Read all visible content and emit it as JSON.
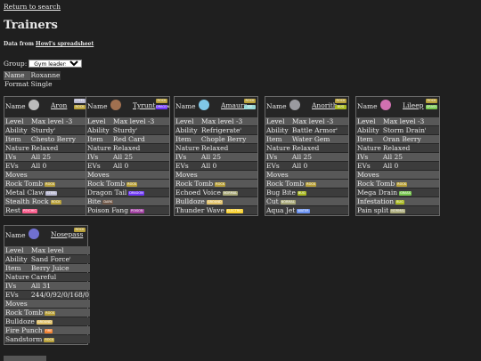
{
  "nav": {
    "back_link": "Return to search"
  },
  "page": {
    "title": "Trainers",
    "data_from_prefix": "Data from ",
    "data_from_link": "Howl's spreadsheet"
  },
  "filter": {
    "group_label": "Group:",
    "group_value": "Gym leaders"
  },
  "trainer": {
    "name_key": "Name",
    "name": "Roxanne",
    "format_key": "Format",
    "format": "Single"
  },
  "labels": {
    "name": "Name",
    "level": "Level",
    "ability": "Ability",
    "item": "Item",
    "nature": "Nature",
    "ivs": "IVs",
    "evs": "EVs",
    "moves": "Moves"
  },
  "type_colors": {
    "ROCK": "#b8a038",
    "STEEL": "#b8b8d0",
    "DRAGON": "#7038f8",
    "DARK": "#705848",
    "POISON": "#a040a0",
    "GRASS": "#78c850",
    "ELECTRIC": "#f8d030",
    "NORMAL": "#a8a878",
    "PSYCHIC": "#f85888",
    "BUG": "#a8b820",
    "WATER": "#6890f0",
    "FIRE": "#f08030",
    "GROUND": "#e0c068",
    "FAIRY": "#ee99ac"
  },
  "pokemon": [
    {
      "name": "Aron",
      "types": [
        "STEEL",
        "ROCK"
      ],
      "icon": "aron-sprite",
      "level": "Max level -3",
      "ability": "Sturdy",
      "item": "Chesto Berry",
      "nature": "Relaxed",
      "ivs": "All 25",
      "evs": "All 0",
      "moves": [
        {
          "name": "Rock Tomb",
          "type": "ROCK"
        },
        {
          "name": "Metal Claw",
          "type": "STEEL"
        },
        {
          "name": "Stealth Rock",
          "type": "ROCK"
        },
        {
          "name": "Rest",
          "type": "PSYCHIC"
        }
      ]
    },
    {
      "name": "Tyrunt",
      "types": [
        "ROCK",
        "DRAGON"
      ],
      "icon": "tyrunt-sprite",
      "level": "Max level -3",
      "ability": "Sturdy",
      "item": "Red Card",
      "nature": "Relaxed",
      "ivs": "All 25",
      "evs": "All 0",
      "moves": [
        {
          "name": "Rock Tomb",
          "type": "ROCK"
        },
        {
          "name": "Dragon Tail",
          "type": "DRAGON"
        },
        {
          "name": "Bite",
          "type": "DARK"
        },
        {
          "name": "Poison Fang",
          "type": "POISON"
        }
      ]
    },
    {
      "name": "Amaura",
      "types": [
        "ROCK",
        "ICE"
      ],
      "icon": "amaura-sprite",
      "level": "Max level -3",
      "ability": "Refrigerate",
      "item": "Chople Berry",
      "nature": "Relaxed",
      "ivs": "All 25",
      "evs": "All 0",
      "moves": [
        {
          "name": "Rock Tomb",
          "type": "ROCK"
        },
        {
          "name": "Echoed Voice",
          "type": "NORMAL"
        },
        {
          "name": "Bulldoze",
          "type": "GROUND"
        },
        {
          "name": "Thunder Wave",
          "type": "ELECTRIC"
        }
      ]
    },
    {
      "name": "Anorith",
      "types": [
        "ROCK",
        "BUG"
      ],
      "icon": "anorith-sprite",
      "level": "Max level -3",
      "ability": "Battle Armor",
      "item": "Water Gem",
      "nature": "Relaxed",
      "ivs": "All 25",
      "evs": "All 0",
      "moves": [
        {
          "name": "Rock Tomb",
          "type": "ROCK"
        },
        {
          "name": "Bug Bite",
          "type": "BUG"
        },
        {
          "name": "Cut",
          "type": "NORMAL"
        },
        {
          "name": "Aqua Jet",
          "type": "WATER"
        }
      ]
    },
    {
      "name": "Lileep",
      "types": [
        "ROCK",
        "GRASS"
      ],
      "icon": "lileep-sprite",
      "level": "Max level -3",
      "ability": "Storm Drain",
      "item": "Oran Berry",
      "nature": "Relaxed",
      "ivs": "All 25",
      "evs": "All 0",
      "moves": [
        {
          "name": "Rock Tomb",
          "type": "ROCK"
        },
        {
          "name": "Mega Drain",
          "type": "GRASS"
        },
        {
          "name": "Infestation",
          "type": "BUG"
        },
        {
          "name": "Pain split",
          "type": "NORMAL"
        }
      ]
    },
    {
      "name": "Nosepass",
      "types": [
        "ROCK"
      ],
      "icon": "nosepass-sprite",
      "level": "Max level",
      "ability": "Sand Force",
      "item": "Berry Juice",
      "nature": "Careful",
      "ivs": "All 31",
      "evs": "244/0/92/0/168/0",
      "moves": [
        {
          "name": "Rock Tomb",
          "type": "ROCK"
        },
        {
          "name": "Bulldoze",
          "type": "GROUND"
        },
        {
          "name": "Fire Punch",
          "type": "FIRE"
        },
        {
          "name": "Sandstorm",
          "type": "ROCK"
        }
      ]
    }
  ]
}
